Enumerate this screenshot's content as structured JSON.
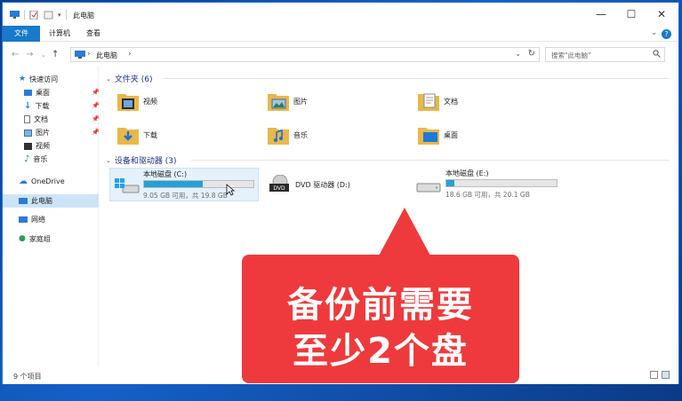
{
  "window": {
    "title": "此电脑",
    "controls": {
      "minimize": "—",
      "maximize": "☐",
      "close": "✕"
    }
  },
  "ribbon": {
    "tabs": [
      "文件",
      "计算机",
      "查看"
    ],
    "help": "?"
  },
  "address": {
    "path": [
      "此电脑"
    ],
    "search_placeholder": "搜索\"此电脑\""
  },
  "sidebar": {
    "items": [
      {
        "label": "快速访问",
        "icon": "star-icon"
      },
      {
        "label": "桌面",
        "icon": "desktop-icon",
        "pinned": true
      },
      {
        "label": "下载",
        "icon": "download-icon",
        "pinned": true
      },
      {
        "label": "文档",
        "icon": "document-icon",
        "pinned": true
      },
      {
        "label": "图片",
        "icon": "picture-icon",
        "pinned": true
      },
      {
        "label": "视频",
        "icon": "video-icon"
      },
      {
        "label": "音乐",
        "icon": "music-icon"
      },
      {
        "label": "OneDrive",
        "icon": "cloud-icon"
      },
      {
        "label": "此电脑",
        "icon": "computer-icon"
      },
      {
        "label": "网络",
        "icon": "network-icon"
      },
      {
        "label": "家庭组",
        "icon": "homegroup-icon"
      }
    ]
  },
  "folders": {
    "header": "文件夹 (6)",
    "items": [
      {
        "label": "视频",
        "icon": "video-folder-icon"
      },
      {
        "label": "图片",
        "icon": "picture-folder-icon"
      },
      {
        "label": "文档",
        "icon": "document-folder-icon"
      },
      {
        "label": "下载",
        "icon": "download-folder-icon"
      },
      {
        "label": "音乐",
        "icon": "music-folder-icon"
      },
      {
        "label": "桌面",
        "icon": "desktop-folder-icon"
      }
    ]
  },
  "devices": {
    "header": "设备和驱动器 (3)",
    "items": [
      {
        "label": "本地磁盘 (C:)",
        "meta": "9.05 GB 可用，共 19.8 GB",
        "used_fraction": 0.54,
        "icon": "windows-drive-icon",
        "selected": true
      },
      {
        "label": "DVD 驱动器 (D:)",
        "meta": "",
        "icon": "dvd-drive-icon"
      },
      {
        "label": "本地磁盘 (E:)",
        "meta": "18.6 GB 可用，共 20.1 GB",
        "used_fraction": 0.07,
        "icon": "hard-drive-icon"
      }
    ]
  },
  "status": {
    "count": "9 个项目"
  },
  "callout": {
    "line1": "备份前需要",
    "line2": "至少2个盘"
  },
  "colors": {
    "accent": "#1979ca",
    "callout": "#ee3a3c",
    "drive_fill": "#26a0da"
  }
}
